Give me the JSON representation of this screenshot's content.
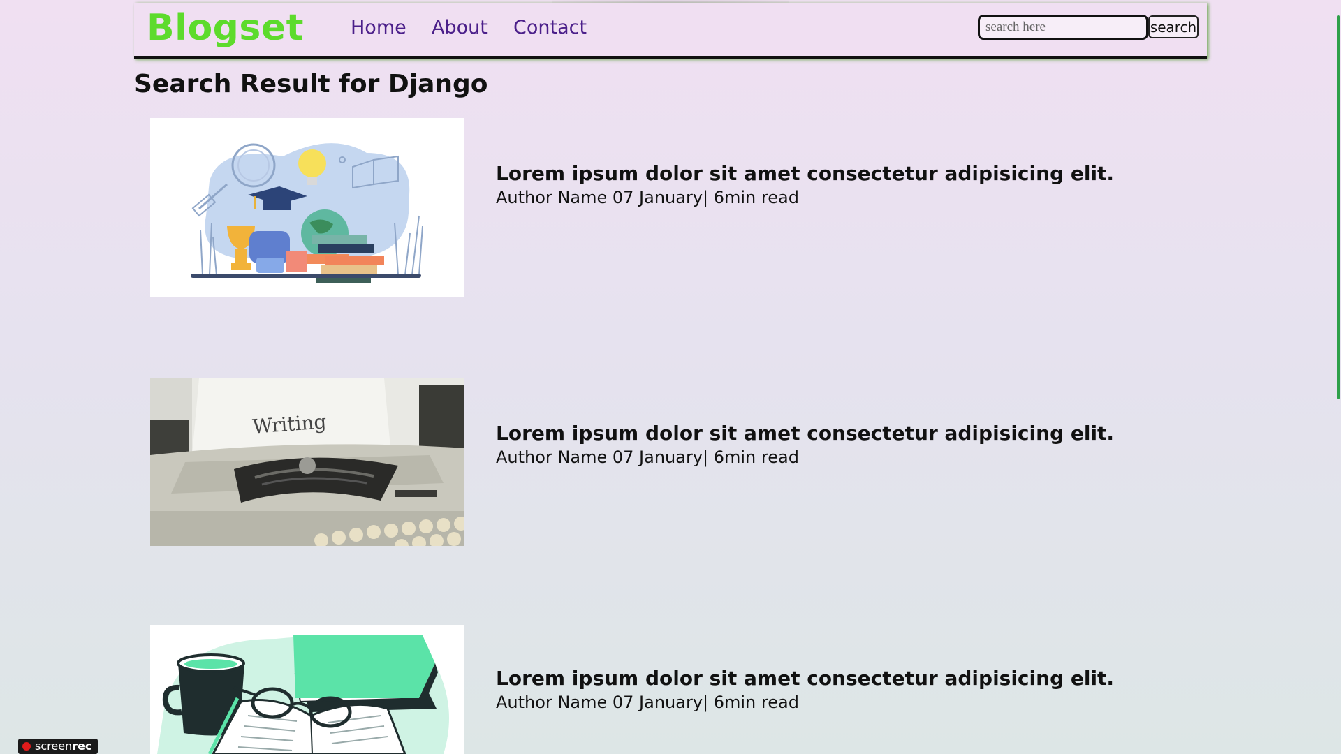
{
  "brand": "Blogset",
  "nav": {
    "home": "Home",
    "about": "About",
    "contact": "Contact"
  },
  "search": {
    "placeholder": "search here",
    "button_label": "search"
  },
  "page_title": "Search Result for Django",
  "posts": [
    {
      "title": "Lorem ipsum dolor sit amet consectetur adipisicing elit.",
      "meta": "Author Name 07 January| 6min read",
      "image": "education-illustration"
    },
    {
      "title": "Lorem ipsum dolor sit amet consectetur adipisicing elit.",
      "meta": "Author Name 07 January| 6min read",
      "image": "typewriter-photo",
      "image_text": "Writing"
    },
    {
      "title": "Lorem ipsum dolor sit amet consectetur adipisicing elit.",
      "meta": "Author Name 07 January| 6min read",
      "image": "books-coffee-illustration"
    }
  ],
  "recorder": {
    "text_light": "screen",
    "text_bold": "rec"
  },
  "colors": {
    "brand": "#5ddb2c",
    "nav_link": "#4b1f8a",
    "navbar_bg": "#f0dff2"
  }
}
